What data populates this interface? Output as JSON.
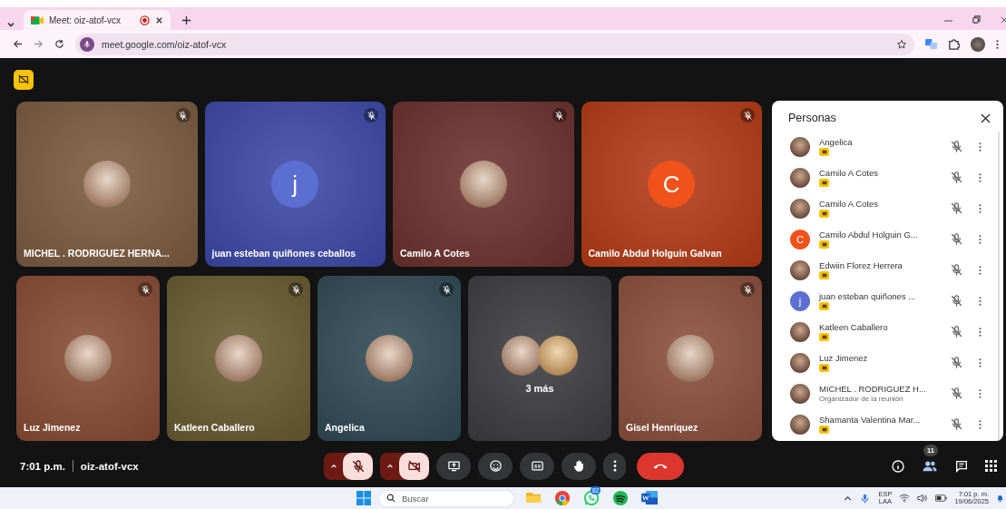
{
  "browser": {
    "tab_title": "Meet: oiz-atof-vcx",
    "url": "meet.google.com/oiz-atof-vcx"
  },
  "tile_rows": [
    {
      "tiles": [
        {
          "kind": "participant",
          "name": "MICHEL . RODRIGUEZ HERNA...",
          "avatar": {
            "kind": "photo"
          },
          "color": "#7a5a40",
          "muted": true
        },
        {
          "kind": "participant",
          "name": "juan esteban quiñones ceballos",
          "avatar": {
            "kind": "initial",
            "letter": "j",
            "color": "#5b6fd0"
          },
          "color": "#3b48a6",
          "muted": true
        },
        {
          "kind": "participant",
          "name": "Camilo A Cotes",
          "avatar": {
            "kind": "photo"
          },
          "color": "#6b302c",
          "muted": true
        },
        {
          "kind": "participant",
          "name": "Camilo Abdul Holguin Galvan",
          "avatar": {
            "kind": "initial",
            "letter": "C",
            "color": "#f0521c"
          },
          "color": "#b33a16",
          "muted": true
        }
      ]
    },
    {
      "tiles": [
        {
          "kind": "participant",
          "name": "Luz Jimenez",
          "avatar": {
            "kind": "photo"
          },
          "color": "#874b33",
          "muted": true
        },
        {
          "kind": "participant",
          "name": "Katleen Caballero",
          "avatar": {
            "kind": "photo"
          },
          "color": "#675a31",
          "muted": true
        },
        {
          "kind": "participant",
          "name": "Angelica",
          "avatar": {
            "kind": "photo"
          },
          "color": "#2f4955",
          "muted": true
        },
        {
          "kind": "more",
          "label": "3 más",
          "color": "#3c3c3f"
        },
        {
          "kind": "participant",
          "name": "Gisel Henríquez",
          "avatar": {
            "kind": "photo"
          },
          "color": "#8a4e3c",
          "muted": true
        }
      ]
    }
  ],
  "people_panel": {
    "title": "Personas",
    "people": [
      {
        "name": "Angelica",
        "avatar": {
          "kind": "photo"
        },
        "muted": true
      },
      {
        "name": "Camilo A Cotes",
        "avatar": {
          "kind": "photo"
        },
        "muted": true
      },
      {
        "name": "Camilo A Cotes",
        "avatar": {
          "kind": "photo"
        },
        "muted": true
      },
      {
        "name": "Camilo Abdul Holguin G...",
        "avatar": {
          "kind": "initial",
          "letter": "C",
          "color": "#f0521c"
        },
        "muted": true
      },
      {
        "name": "Edwiin Florez Herrera",
        "avatar": {
          "kind": "photo"
        },
        "muted": true
      },
      {
        "name": "juan esteban quiñones ...",
        "avatar": {
          "kind": "initial",
          "letter": "j",
          "color": "#5b6fd0"
        },
        "muted": true
      },
      {
        "name": "Katleen Caballero",
        "avatar": {
          "kind": "photo"
        },
        "muted": true
      },
      {
        "name": "Luz Jimenez",
        "avatar": {
          "kind": "photo"
        },
        "muted": true
      },
      {
        "name": "MICHEL . RODRIGUEZ H...",
        "subtitle": "Organizador de la reunión",
        "avatar": {
          "kind": "photo"
        },
        "muted": true
      },
      {
        "name": "Shamanta Valentina Mar...",
        "avatar": {
          "kind": "photo"
        },
        "muted": true
      }
    ]
  },
  "call_bar": {
    "time": "7:01 p.m.",
    "meeting_code": "oiz-atof-vcx",
    "mic": {
      "on": false
    },
    "camera": {
      "on": false
    },
    "actions": [
      {
        "kind": "present"
      },
      {
        "kind": "emoji"
      },
      {
        "kind": "captions"
      },
      {
        "kind": "hand"
      },
      {
        "kind": "more"
      }
    ],
    "people_count": "11"
  },
  "taskbar": {
    "search_placeholder": "Buscar",
    "apps": [
      {
        "kind": "files"
      },
      {
        "kind": "chrome"
      },
      {
        "kind": "whatsapp",
        "badge": "82"
      },
      {
        "kind": "spotify"
      },
      {
        "kind": "word"
      }
    ],
    "lang_1": "ESP",
    "lang_2": "LAA",
    "clock_time": "7:01 p. m.",
    "clock_date": "19/06/2025"
  }
}
